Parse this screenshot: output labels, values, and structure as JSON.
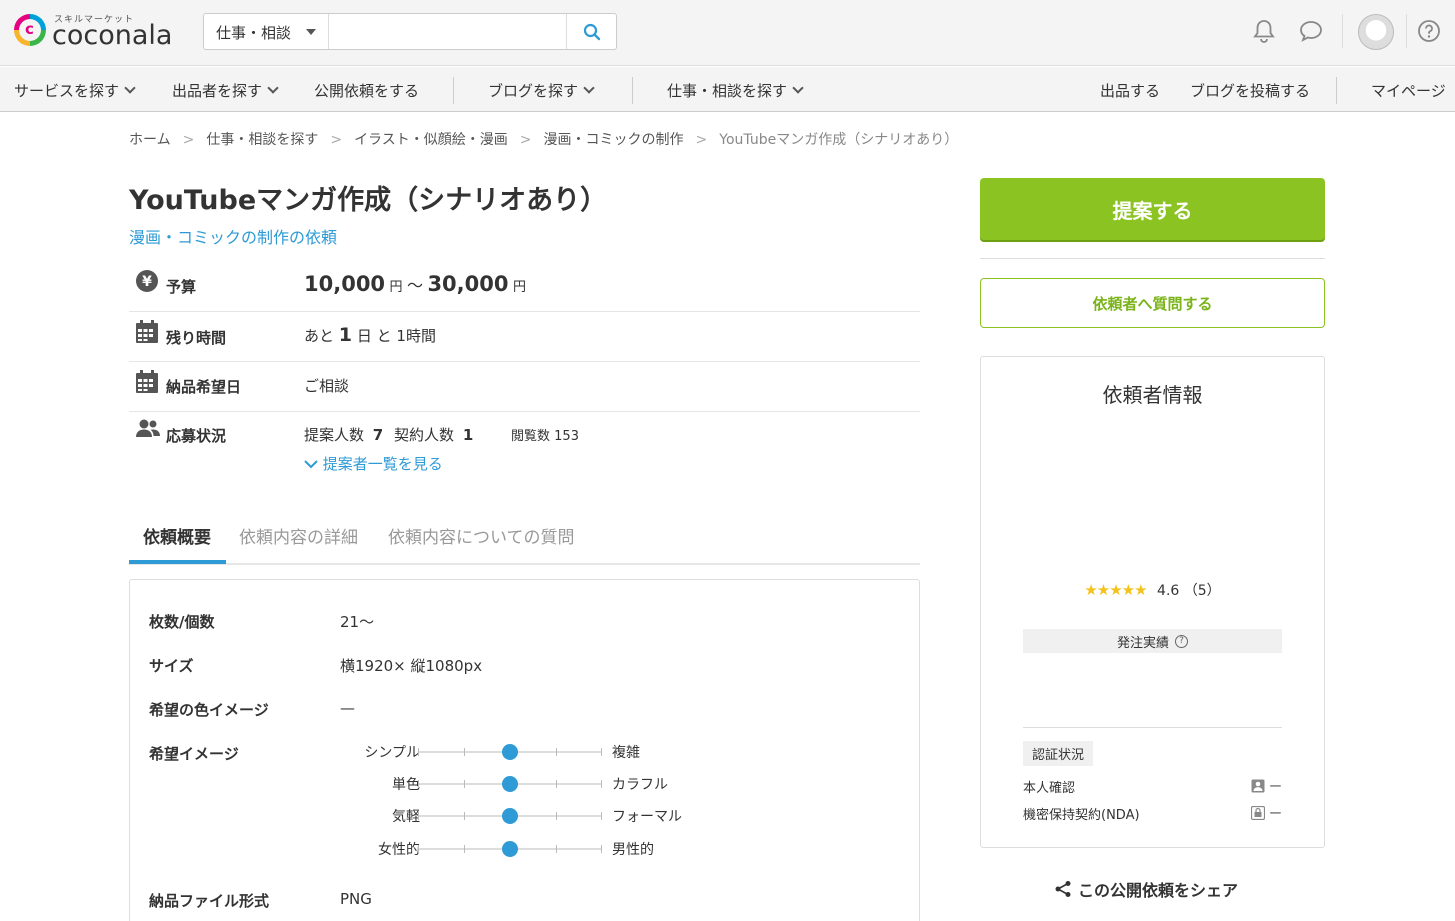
{
  "header": {
    "logo_small": "スキルマーケット",
    "logo_text": "coconala",
    "search_category": "仕事・相談",
    "search_placeholder": ""
  },
  "nav": {
    "items": [
      "サービスを探す",
      "出品者を探す",
      "公開依頼をする",
      "ブログを探す",
      "仕事・相談を探す",
      "出品する",
      "ブログを投稿する",
      "マイページ"
    ]
  },
  "breadcrumb": [
    "ホーム",
    "仕事・相談を探す",
    "イラスト・似顔絵・漫画",
    "漫画・コミックの制作",
    "YouTubeマンガ作成（シナリオあり）"
  ],
  "request": {
    "title": "YouTubeマンガ作成（シナリオあり）",
    "category": "漫画・コミックの制作の依頼"
  },
  "info": {
    "budget_label": "予算",
    "budget_min": "10,000",
    "budget_max": "30,000",
    "yen": "円",
    "tilde": "〜",
    "remaining_label": "残り時間",
    "remaining_prefix": "あと",
    "remaining_days": "1",
    "remaining_day_unit": "日",
    "remaining_and": "と",
    "remaining_hours": "1時間",
    "deadline_label": "納品希望日",
    "deadline_value": "ご相談",
    "status_label": "応募状況",
    "proposals_label": "提案人数",
    "proposals_count": "7",
    "contracts_label": "契約人数",
    "contracts_count": "1",
    "views_label": "閲覧数",
    "views_count": "153",
    "proposer_list_link": "提案者一覧を見る"
  },
  "tabs": [
    "依頼概要",
    "依頼内容の詳細",
    "依頼内容についての質問"
  ],
  "details": {
    "count_label": "枚数/個数",
    "count_value": "21〜",
    "size_label": "サイズ",
    "size_value": "横1920× 縦1080px",
    "color_label": "希望の色イメージ",
    "color_value": "—",
    "image_label": "希望イメージ",
    "sliders": [
      {
        "left": "シンプル",
        "right": "複雑",
        "level": 0.5
      },
      {
        "left": "単色",
        "right": "カラフル",
        "level": 0.5
      },
      {
        "left": "気軽",
        "right": "フォーマル",
        "level": 0.5
      },
      {
        "left": "女性的",
        "right": "男性的",
        "level": 0.5
      }
    ],
    "format_label": "納品ファイル形式",
    "format_value": "PNG"
  },
  "sidebar": {
    "propose_button": "提案する",
    "ask_button": "依頼者へ質問する",
    "client_title": "依頼者情報",
    "rating_value": "4.6",
    "rating_count": "（5）",
    "rating_stars": 4.6,
    "performance_label": "発注実績",
    "auth_badge": "認証状況",
    "identity_label": "本人確認",
    "identity_status": "ー",
    "nda_label": "機密保持契約(NDA)",
    "nda_status": "ー",
    "share_label": "この公開依頼をシェア"
  },
  "colors": {
    "accent_green": "#8ac322",
    "link_blue": "#2e9bd6",
    "star_yellow": "#f5c21b"
  }
}
